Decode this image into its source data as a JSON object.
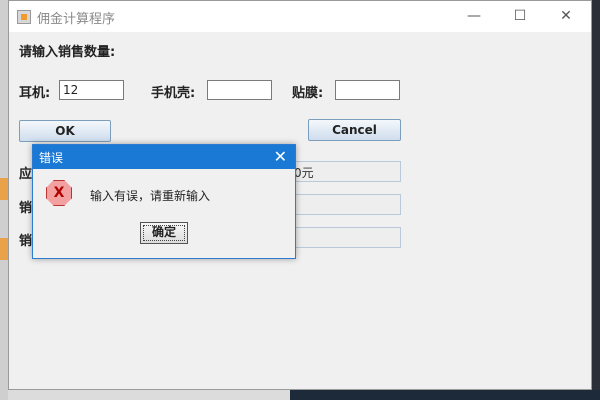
{
  "window": {
    "title": "佣金计算程序",
    "controls": {
      "minimize": "—",
      "maximize": "☐",
      "close": "✕"
    }
  },
  "form": {
    "prompt": "请输入销售数量:",
    "earphone_label": "耳机:",
    "earphone_value": "12",
    "phonecase_label": "手机壳:",
    "phonecase_value": "",
    "film_label": "贴膜:",
    "film_value": ""
  },
  "buttons": {
    "ok": "OK",
    "cancel": "Cancel"
  },
  "results": {
    "row1_label_partial": "应",
    "row1_value_partial": "0元",
    "row2_label_partial": "销",
    "row3_label_partial": "销"
  },
  "dialog": {
    "title": "错误",
    "close": "✕",
    "icon": "error-icon",
    "icon_glyph": "X",
    "message": "输入有误，请重新输入",
    "ok_label": "确定"
  },
  "colors": {
    "dialog_titlebar": "#1b79d6",
    "error_icon": "#f2a0a0"
  }
}
